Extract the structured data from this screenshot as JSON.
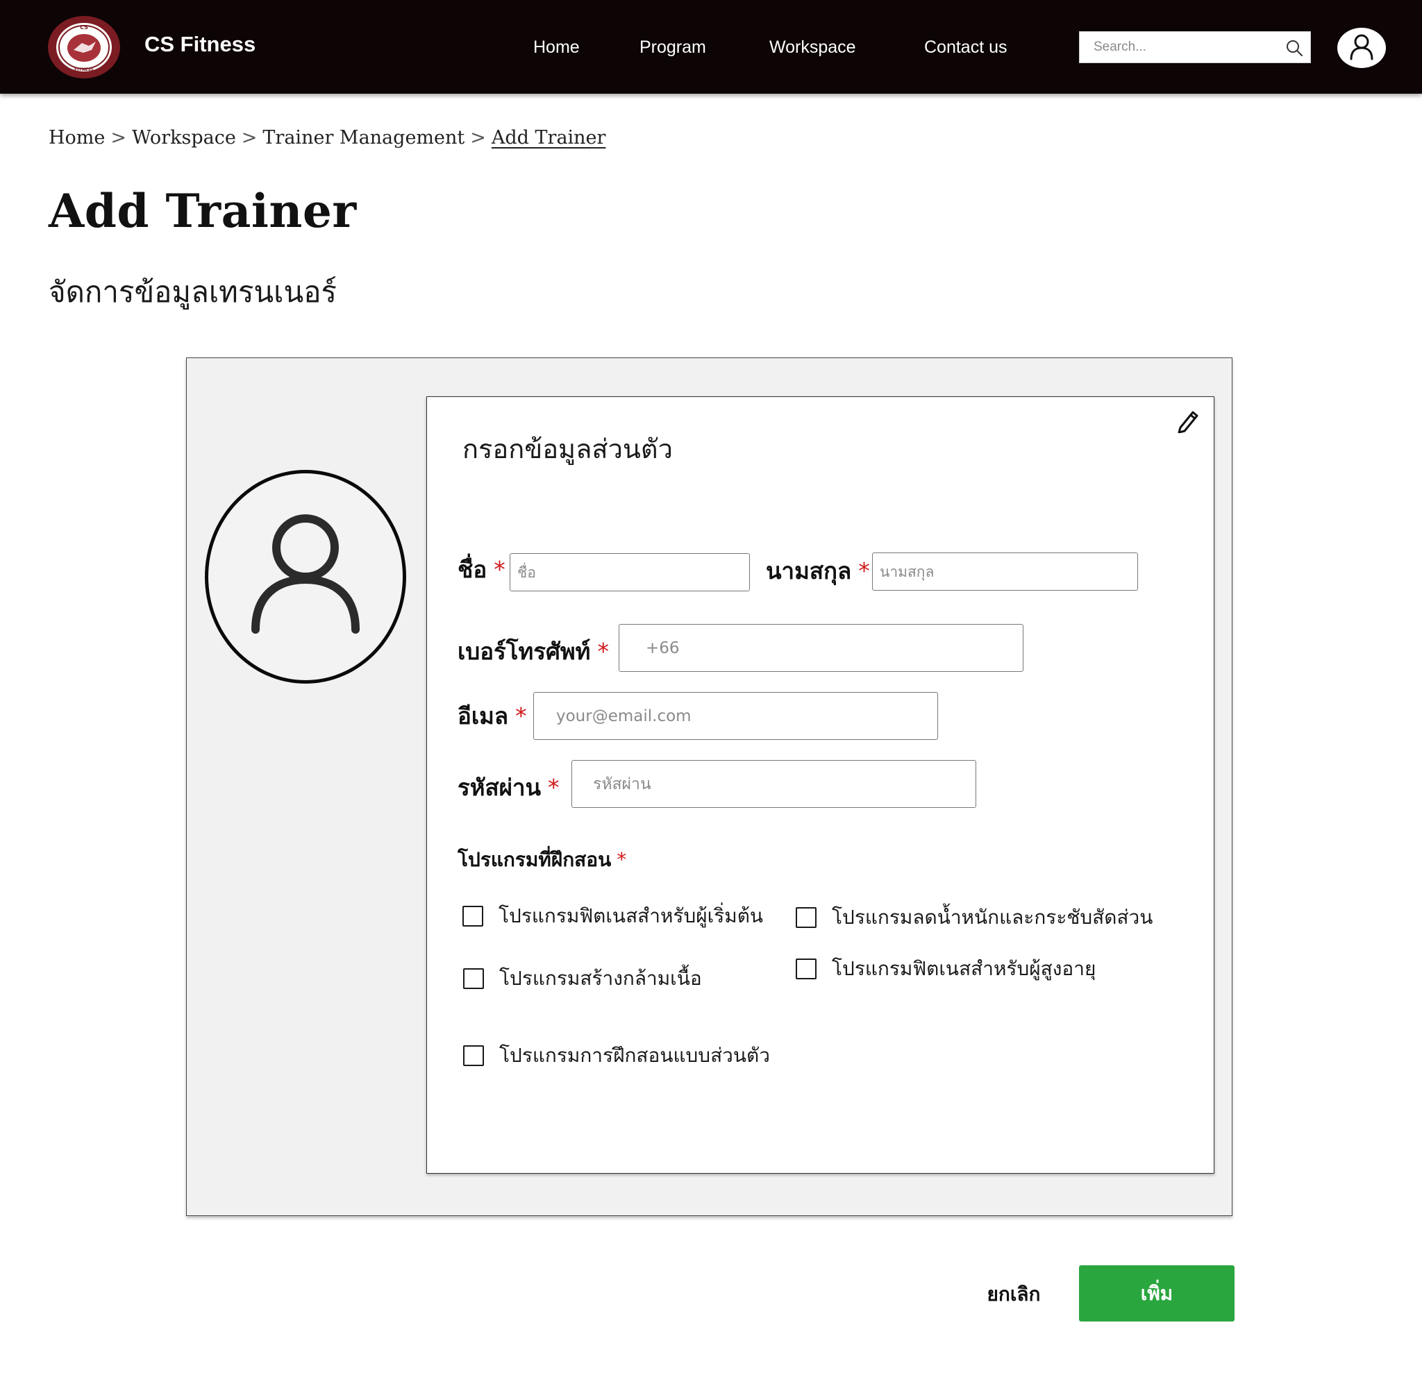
{
  "header": {
    "brand": "CS Fitness",
    "logo_text_top": "CS",
    "logo_text_bottom": "FITNESS",
    "nav": [
      "Home",
      "Program",
      "Workspace",
      "Contact us"
    ],
    "search_placeholder": "Search..."
  },
  "breadcrumb": {
    "items": [
      "Home",
      "Workspace",
      "Trainer Management"
    ],
    "current": "Add Trainer",
    "separator": ">"
  },
  "page": {
    "title": "Add Trainer",
    "subtitle": "จัดการข้อมูลเทรนเนอร์"
  },
  "form": {
    "card_title": "กรอกข้อมูลส่วนตัว",
    "required_mark": "*",
    "first_name": {
      "label": "ชื่อ",
      "placeholder": "ชื่อ"
    },
    "last_name": {
      "label": "นามสกุล",
      "placeholder": "นามสกุล"
    },
    "phone": {
      "label": "เบอร์โทรศัพท์",
      "placeholder": "+66"
    },
    "email": {
      "label": "อีเมล",
      "placeholder": "your@email.com"
    },
    "password": {
      "label": "รหัสผ่าน",
      "placeholder": "รหัสผ่าน"
    },
    "programs_label": "โปรแกรมที่ฝึกสอน",
    "programs": [
      "โปรแกรมฟิตเนสสำหรับผู้เริ่มต้น",
      "โปรแกรมลดน้ำหนักและกระชับสัดส่วน",
      "โปรแกรมสร้างกล้ามเนื้อ",
      "โปรแกรมฟิตเนสสำหรับผู้สูงอายุ",
      "โปรแกรมการฝึกสอนแบบส่วนตัว"
    ]
  },
  "actions": {
    "cancel": "ยกเลิก",
    "submit": "เพิ่ม"
  },
  "colors": {
    "header_bg": "#0d0405",
    "logo_red": "#7a1c22",
    "required": "#d11a1a",
    "submit_bg": "#2aa63e",
    "panel_bg": "#f1f1f1"
  }
}
